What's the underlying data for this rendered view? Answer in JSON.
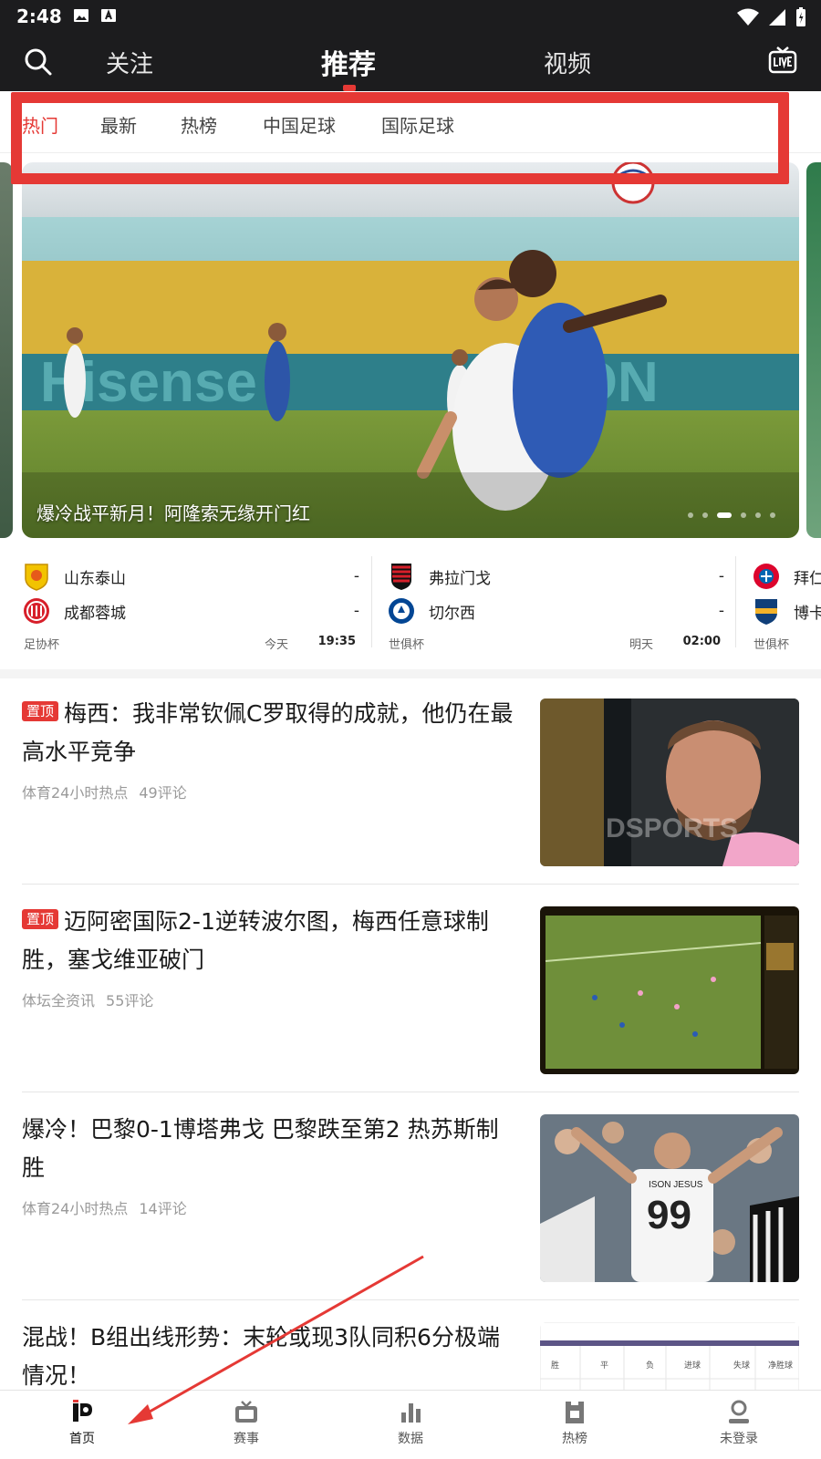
{
  "status_bar": {
    "time": "2:48"
  },
  "top_nav": {
    "tabs": [
      {
        "label": "关注"
      },
      {
        "label": "推荐"
      },
      {
        "label": "视频"
      }
    ]
  },
  "sub_tabs": [
    "热门",
    "最新",
    "热榜",
    "中国足球",
    "国际足球"
  ],
  "carousel": {
    "caption": "爆冷战平新月！阿隆索无缘开门红",
    "dot_count": 6,
    "active_dot": 3
  },
  "matches": [
    {
      "home": "山东泰山",
      "home_score": "-",
      "away": "成都蓉城",
      "away_score": "-",
      "competition": "足协杯",
      "day": "今天",
      "time": "19:35"
    },
    {
      "home": "弗拉门戈",
      "home_score": "-",
      "away": "切尔西",
      "away_score": "-",
      "competition": "世俱杯",
      "day": "明天",
      "time": "02:00"
    },
    {
      "home": "拜仁",
      "away": "博卡",
      "competition": "世俱杯"
    }
  ],
  "news": [
    {
      "pinned": true,
      "pin_label": "置顶",
      "title": "梅西：我非常钦佩C罗取得的成就，他仍在最高水平竞争",
      "source": "体育24小时热点",
      "comments": "49评论"
    },
    {
      "pinned": true,
      "pin_label": "置顶",
      "title": "迈阿密国际2-1逆转波尔图，梅西任意球制胜，塞戈维亚破门",
      "source": "体坛全资讯",
      "comments": "55评论"
    },
    {
      "pinned": false,
      "title": "爆冷！巴黎0-1博塔弗戈 巴黎跌至第2 热苏斯制胜",
      "source": "体育24小时热点",
      "comments": "14评论"
    },
    {
      "pinned": false,
      "title": "混战！B组出线形势：末轮或现3队同积6分极端情况！",
      "source": "",
      "comments": ""
    }
  ],
  "thumb_texts": {
    "messi_logo": "DSPORTS",
    "jersey_name": "ISON JESUS",
    "jersey_number": "99",
    "table_headers": [
      "胜",
      "平",
      "负",
      "进球",
      "失球",
      "净胜球"
    ]
  },
  "bottom_nav": [
    {
      "label": "首页",
      "icon": "home-logo-icon"
    },
    {
      "label": "赛事",
      "icon": "tv-icon"
    },
    {
      "label": "数据",
      "icon": "bar-chart-icon"
    },
    {
      "label": "热榜",
      "icon": "trophy-icon"
    },
    {
      "label": "未登录",
      "icon": "user-icon"
    }
  ],
  "colors": {
    "accent": "#e53935",
    "header_bg": "#1c1c1e",
    "annotation": "#e53935"
  }
}
